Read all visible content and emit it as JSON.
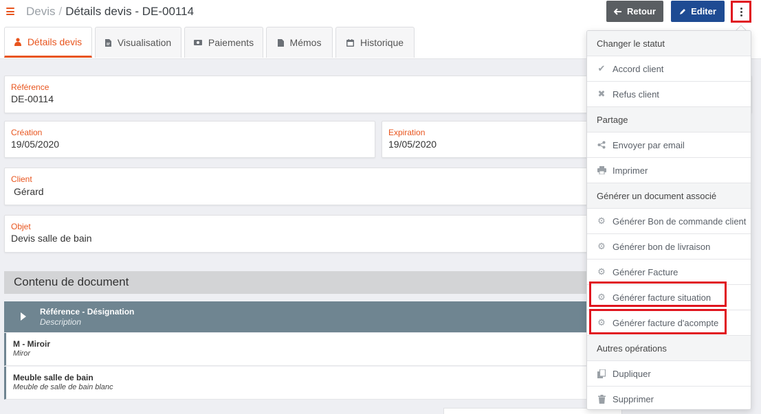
{
  "header": {
    "breadcrumb_root": "Devis",
    "breadcrumb_separator": "/",
    "page_title": "Détails devis - DE-00114",
    "back_button": "Retour",
    "edit_button": "Editer"
  },
  "tabs": [
    {
      "label": "Détails devis",
      "icon": "user-icon",
      "active": true
    },
    {
      "label": "Visualisation",
      "icon": "file-icon",
      "active": false
    },
    {
      "label": "Paiements",
      "icon": "money-icon",
      "active": false
    },
    {
      "label": "Mémos",
      "icon": "note-icon",
      "active": false
    },
    {
      "label": "Historique",
      "icon": "calendar-icon",
      "active": false
    }
  ],
  "fields": {
    "reference": {
      "label": "Référence",
      "value": "DE-00114"
    },
    "creation": {
      "label": "Création",
      "value": "19/05/2020"
    },
    "expiration": {
      "label": "Expiration",
      "value": "19/05/2020"
    },
    "client": {
      "label": "Client",
      "value": "Gérard"
    },
    "objet": {
      "label": "Objet",
      "value": "Devis salle de bain"
    }
  },
  "content": {
    "section_title": "Contenu de document",
    "table_header": {
      "title": "Référence - Désignation",
      "subtitle": "Description"
    },
    "rows": [
      {
        "title": "M - Miroir",
        "subtitle": "Miror"
      },
      {
        "title": "Meuble salle de bain",
        "subtitle": "Meuble de salle de bain blanc"
      }
    ]
  },
  "menu": {
    "status_header": "Changer le statut",
    "accord": "Accord client",
    "refus": "Refus client",
    "share_header": "Partage",
    "email": "Envoyer par email",
    "print": "Imprimer",
    "generate_header": "Générer un document associé",
    "gen_bon_commande": "Générer Bon de commande client",
    "gen_bon_livraison": "Générer bon de livraison",
    "gen_facture": "Générer Facture",
    "gen_facture_situation": "Générer facture situation",
    "gen_facture_acompte": "Générer facture d'acompte",
    "other_header": "Autres opérations",
    "duplicate": "Dupliquer",
    "delete": "Supprimer"
  },
  "colors": {
    "accent": "#e8541d",
    "primary": "#1e4b93",
    "highlight": "#e0141e"
  }
}
